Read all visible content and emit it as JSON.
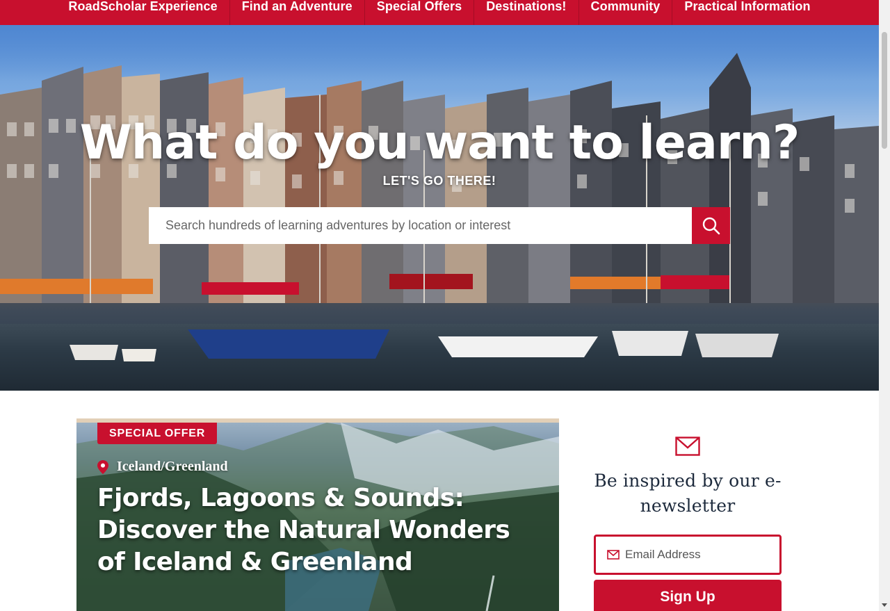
{
  "nav": {
    "items": [
      {
        "label": "RoadScholar Experience"
      },
      {
        "label": "Find an Adventure"
      },
      {
        "label": "Special Offers"
      },
      {
        "label": "Destinations!"
      },
      {
        "label": "Community"
      },
      {
        "label": "Practical Information"
      }
    ]
  },
  "hero": {
    "title": "What do you want to learn?",
    "subtitle": "LET'S GO THERE!",
    "search_placeholder": "Search hundreds of learning adventures by location or interest",
    "search_icon": "search-icon"
  },
  "card": {
    "badge": "SPECIAL OFFER",
    "location_icon": "map-pin-icon",
    "location": "Iceland/Greenland",
    "title": "Fjords, Lagoons & Sounds: Discover the Natural Wonders of Iceland & Greenland"
  },
  "newsletter": {
    "icon": "envelope-icon",
    "heading": "Be inspired by our e-newsletter",
    "email_placeholder": "Email Address",
    "signup_label": "Sign Up"
  },
  "colors": {
    "brand_red": "#c8102e",
    "heading_navy": "#1d2a3c"
  }
}
